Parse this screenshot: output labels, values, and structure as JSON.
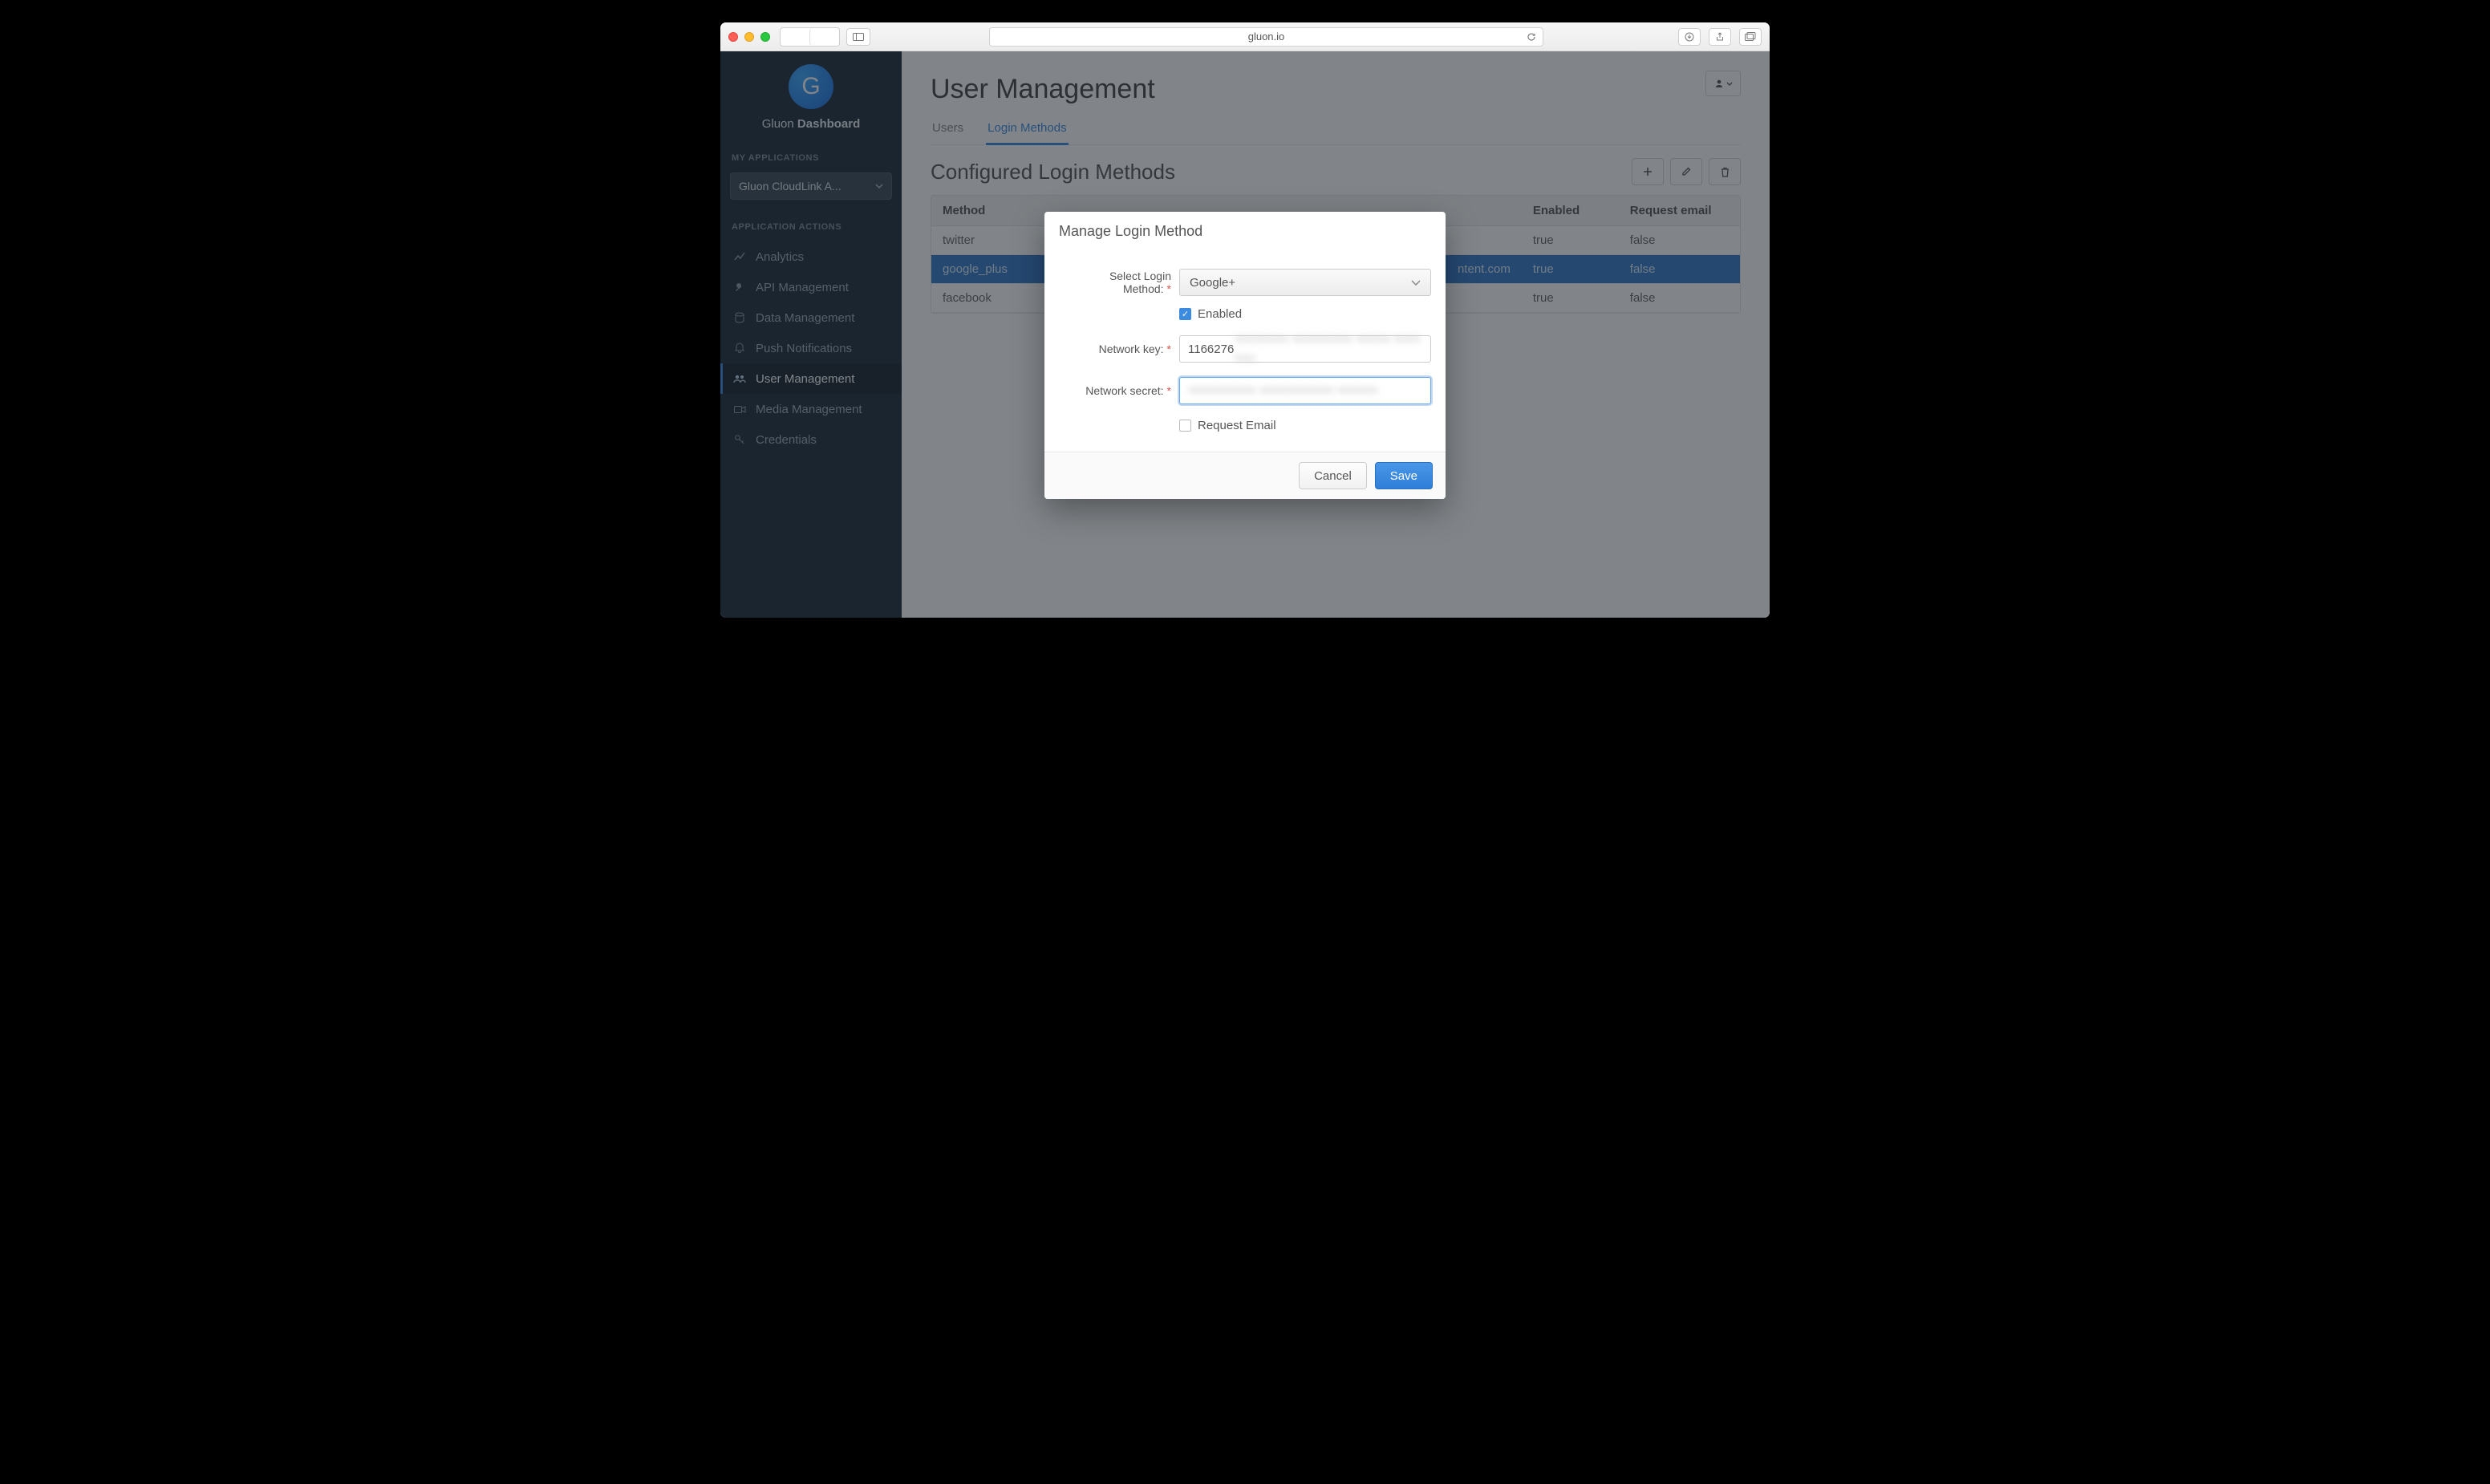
{
  "browser": {
    "url": "gluon.io"
  },
  "sidebar": {
    "brand_prefix": "Gluon ",
    "brand_bold": "Dashboard",
    "logo_letter": "G",
    "section_apps": "MY APPLICATIONS",
    "app_selected": "Gluon CloudLink A...",
    "section_actions": "APPLICATION ACTIONS",
    "items": [
      {
        "icon": "analytics",
        "label": "Analytics"
      },
      {
        "icon": "wrench",
        "label": "API Management"
      },
      {
        "icon": "db",
        "label": "Data Management"
      },
      {
        "icon": "bell",
        "label": "Push Notifications"
      },
      {
        "icon": "users",
        "label": "User Management"
      },
      {
        "icon": "video",
        "label": "Media Management"
      },
      {
        "icon": "key",
        "label": "Credentials"
      }
    ]
  },
  "main": {
    "page_title": "User Management",
    "tabs": [
      {
        "label": "Users"
      },
      {
        "label": "Login Methods"
      }
    ],
    "subtitle": "Configured Login Methods",
    "columns": {
      "c0": "Method",
      "c1": "Enabled",
      "c2": "Request email"
    },
    "rows": [
      {
        "method": "twitter",
        "mid": "",
        "enabled": "true",
        "reqemail": "false"
      },
      {
        "method": "google_plus",
        "mid": "ntent.com",
        "enabled": "true",
        "reqemail": "false"
      },
      {
        "method": "facebook",
        "mid": "",
        "enabled": "true",
        "reqemail": "false"
      }
    ]
  },
  "modal": {
    "title": "Manage Login Method",
    "label_method": "Select Login Method:",
    "method_value": "Google+",
    "enabled_label": "Enabled",
    "label_key": "Network key:",
    "key_prefix": "1166276",
    "key_blur": "ฯฯฯฯฯฯฯฯ ฯฯฯฯฯฯฯฯฯ ฯฯฯฯฯ ฯฯฯฯ ฯฯฯ",
    "label_secret": "Network secret:",
    "secret_blur": "ฯฯฯฯฯฯฯฯฯฯ ฯฯฯฯฯฯฯฯฯฯฯ ฯฯฯฯฯฯ",
    "request_email_label": "Request Email",
    "cancel": "Cancel",
    "save": "Save"
  }
}
